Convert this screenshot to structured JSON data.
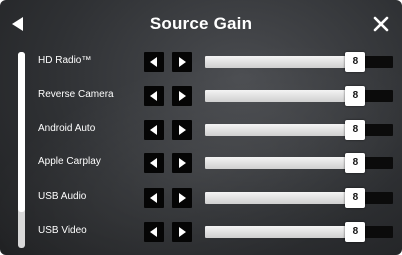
{
  "header": {
    "title": "Source Gain",
    "back_icon": "back-arrow-icon",
    "close_icon": "close-icon"
  },
  "rows": [
    {
      "label": "HD Radio™",
      "value": "8",
      "level": 0.8
    },
    {
      "label": "Reverse Camera",
      "value": "8",
      "level": 0.8
    },
    {
      "label": "Android Auto",
      "value": "8",
      "level": 0.8
    },
    {
      "label": "Apple Carplay",
      "value": "8",
      "level": 0.8
    },
    {
      "label": "USB Audio",
      "value": "8",
      "level": 0.8
    },
    {
      "label": "USB Video",
      "value": "8",
      "level": 0.8
    }
  ],
  "icons": {
    "decrease": "triangle-left-icon",
    "increase": "triangle-right-icon"
  },
  "colors": {
    "background": "#2f3134",
    "text": "#ffffff",
    "button": "#050505",
    "slider_fill": "#e6e6e6",
    "slider_track": "#0b0b0b"
  }
}
